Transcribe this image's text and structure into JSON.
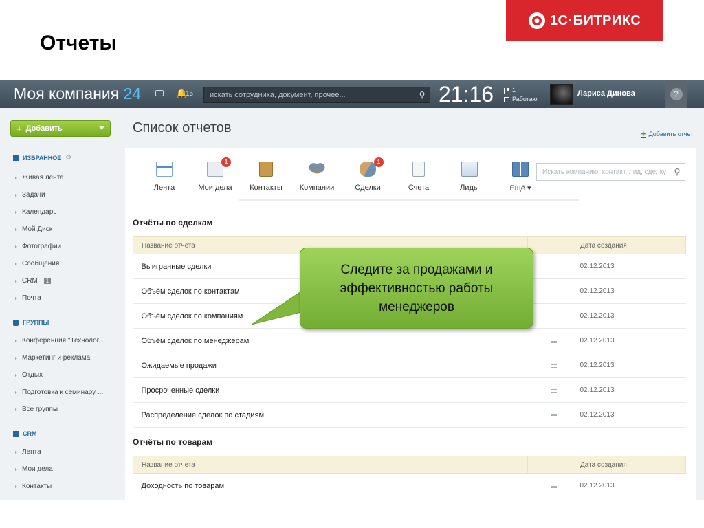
{
  "slide": {
    "title": "Отчеты"
  },
  "brand": {
    "text": "1С·БИТРИКС",
    "color": "#d8262c"
  },
  "topbar": {
    "company": "Моя компания",
    "company_num": "24",
    "notifications": "15",
    "search_placeholder": "искать сотрудника, документ, прочее...",
    "clock": "21:16",
    "flag_count": "1",
    "status": "Работаю",
    "user_name": "Лариса Динова",
    "help": "?"
  },
  "sidebar": {
    "add_button": "Добавить",
    "sections": [
      {
        "title": "ИЗБРАННОЕ",
        "items": [
          "Живая лента",
          "Задачи",
          "Календарь",
          "Мой Диск",
          "Фотографии",
          "Сообщения",
          "CRM",
          "Почта"
        ]
      },
      {
        "title": "ГРУППЫ",
        "items": [
          "Конференция \"Технолог...",
          "Маркетинг и реклама",
          "Отдых",
          "Подготовка к семинару ...",
          "Все группы"
        ]
      },
      {
        "title": "CRM",
        "items": [
          "Лента",
          "Мои дела",
          "Контакты"
        ]
      }
    ],
    "crm_badge": "1"
  },
  "page": {
    "title": "Список отчетов",
    "add_report": "Добавить отчет"
  },
  "crm_toolbar": {
    "items": [
      {
        "label": "Лента",
        "icon": "feed-icon",
        "badge": ""
      },
      {
        "label": "Мои дела",
        "icon": "tasks-icon",
        "badge": "1"
      },
      {
        "label": "Контакты",
        "icon": "contacts-icon",
        "badge": ""
      },
      {
        "label": "Компании",
        "icon": "companies-icon",
        "badge": ""
      },
      {
        "label": "Сделки",
        "icon": "deals-icon",
        "badge": "1"
      },
      {
        "label": "Счета",
        "icon": "invoices-icon",
        "badge": ""
      },
      {
        "label": "Лиды",
        "icon": "leads-icon",
        "badge": ""
      },
      {
        "label": "Ещё",
        "icon": "more-icon",
        "badge": ""
      }
    ],
    "search_placeholder": "Искать компанию, контакт, лид, сделку"
  },
  "reports": {
    "deals_title": "Отчёты по сделкам",
    "goods_title": "Отчёты по товарам",
    "col_name": "Название отчета",
    "col_date": "Дата создания",
    "deals": [
      {
        "name": "Выигранные сделки",
        "date": "02.12.2013"
      },
      {
        "name": "Объём сделок по контактам",
        "date": "02.12.2013"
      },
      {
        "name": "Объём сделок по компаниям",
        "date": "02.12.2013"
      },
      {
        "name": "Объём сделок по менеджерам",
        "date": "02.12.2013"
      },
      {
        "name": "Ожидаемые продажи",
        "date": "02.12.2013"
      },
      {
        "name": "Просроченные сделки",
        "date": "02.12.2013"
      },
      {
        "name": "Распределение сделок по стадиям",
        "date": "02.12.2013"
      }
    ],
    "goods": [
      {
        "name": "Доходность по товарам",
        "date": "02.12.2013"
      }
    ]
  },
  "callout": {
    "text": "Следите за продажами и эффективностью работы менеджеров"
  }
}
